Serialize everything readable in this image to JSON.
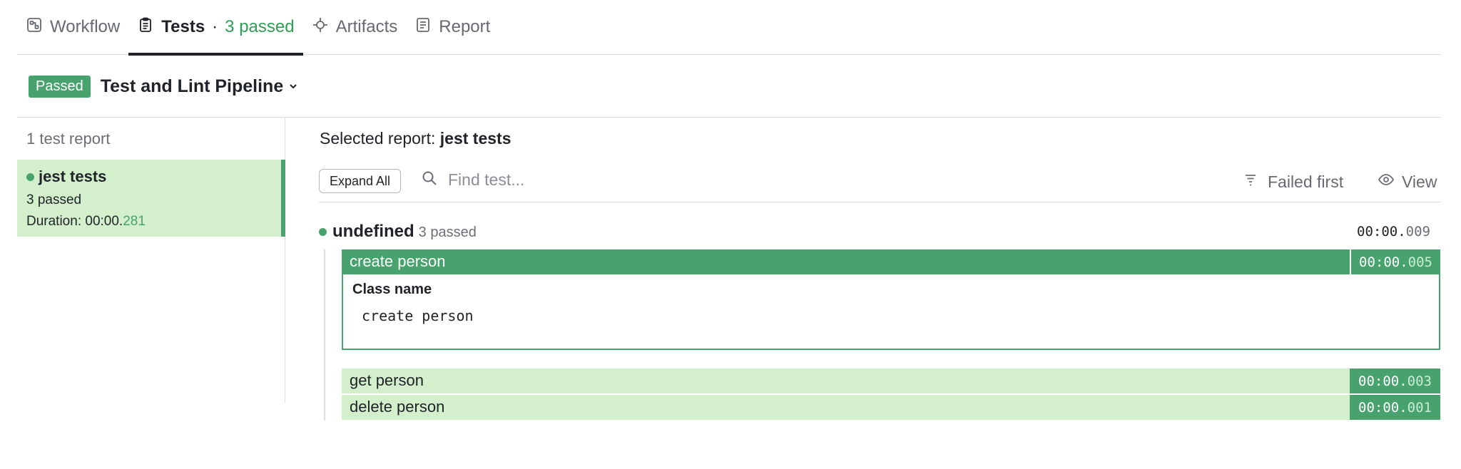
{
  "tabs": [
    {
      "label": "Workflow",
      "icon": "workflow-icon"
    },
    {
      "label": "Tests",
      "separator": "·",
      "count": "3 passed",
      "icon": "clipboard-icon"
    },
    {
      "label": "Artifacts",
      "icon": "artifacts-icon"
    },
    {
      "label": "Report",
      "icon": "report-icon"
    }
  ],
  "pipeline": {
    "status": "Passed",
    "title": "Test and Lint Pipeline",
    "status_color": "#47a26e"
  },
  "sidebar": {
    "title": "1 test report",
    "reports": [
      {
        "name": "jest tests",
        "passed": "3 passed",
        "duration_prefix": "Duration: 00:00.",
        "duration_ms": "281"
      }
    ]
  },
  "main": {
    "selected_prefix": "Selected report:",
    "selected_name": "jest tests",
    "expand_all": "Expand All",
    "search_placeholder": "Find test...",
    "failed_first": "Failed first",
    "view": "View"
  },
  "suite": {
    "name": "undefined",
    "count": "3 passed",
    "time_prefix": "00:00.",
    "time_ms": "009",
    "tests": [
      {
        "name": "create person",
        "time_prefix": "00:00.",
        "time_ms": "005",
        "expanded": true,
        "detail_label": "Class name",
        "detail_value": "create person"
      },
      {
        "name": "get person",
        "time_prefix": "00:00.",
        "time_ms": "003"
      },
      {
        "name": "delete person",
        "time_prefix": "00:00.",
        "time_ms": "001"
      }
    ]
  },
  "colors": {
    "accent": "#47a26e",
    "light_green": "#d4efcc",
    "passed_text": "#2f9e56"
  }
}
